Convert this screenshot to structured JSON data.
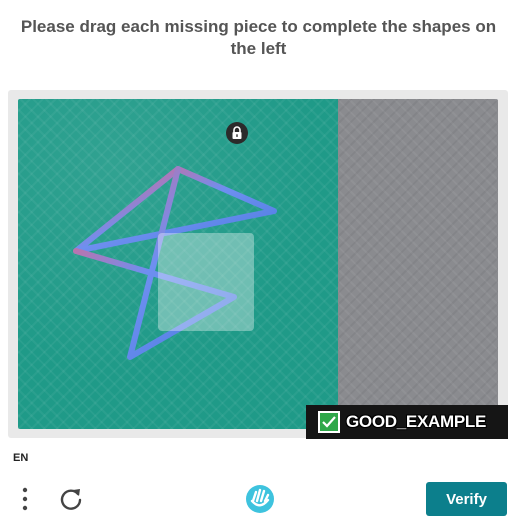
{
  "prompt": {
    "title": "Please drag each missing piece to complete the shapes on the left"
  },
  "watermark": {
    "label": "GOOD_EXAMPLE"
  },
  "language": {
    "code": "EN"
  },
  "footer": {
    "verify_label": "Verify"
  },
  "icons": {
    "lock": "lock-icon",
    "menu": "vertical-dots-icon",
    "refresh": "refresh-icon",
    "brand": "hand-logo-icon",
    "check": "checkmark-icon"
  },
  "colors": {
    "target_background": "#1f9a88",
    "piece_bay_background": "#8a8b8f",
    "verify_button": "#0c7f8c",
    "watermark_background": "#151515",
    "check_green": "#2fa84a"
  }
}
